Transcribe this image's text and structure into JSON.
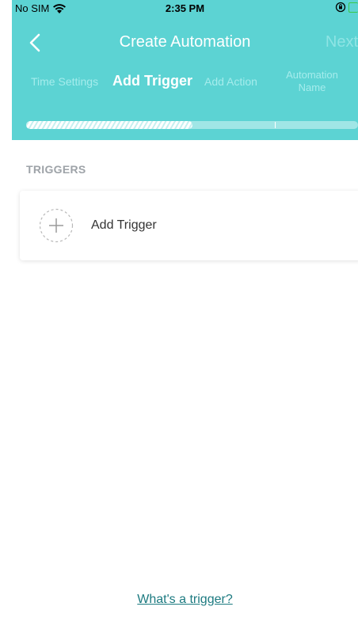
{
  "status_bar": {
    "carrier": "No SIM",
    "time": "2:35 PM"
  },
  "nav": {
    "title": "Create Automation",
    "next_label": "Next"
  },
  "steps": [
    {
      "label": "Time Settings",
      "active": false
    },
    {
      "label": "Add Trigger",
      "active": true
    },
    {
      "label": "Add Action",
      "active": false
    },
    {
      "label": "Automation Name",
      "active": false
    }
  ],
  "progress": {
    "current_step": 2,
    "total_steps": 4,
    "fill_fraction": 0.5
  },
  "triggers_section": {
    "title": "TRIGGERS",
    "add_label": "Add Trigger"
  },
  "help_link": "What's a trigger?",
  "colors": {
    "header": "#5cd3d3",
    "link": "#1c7a80",
    "section_title": "#9ea3a8"
  }
}
